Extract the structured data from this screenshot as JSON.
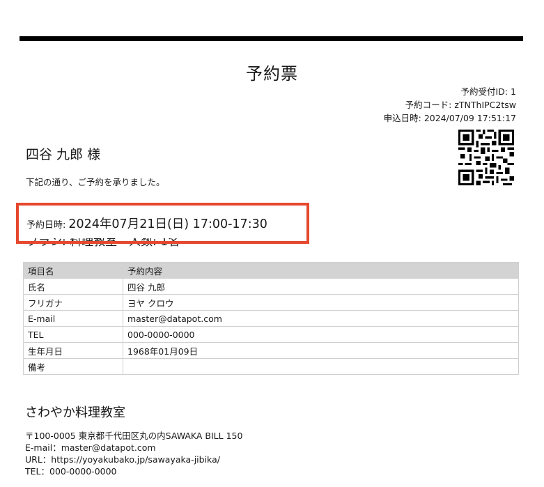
{
  "document": {
    "title": "予約票"
  },
  "meta": {
    "reception_id": "予約受付ID: 1",
    "reservation_code": "予約コード: zTNThIPC2tsw",
    "applied_at": "申込日時: 2024/07/09 17:51:17"
  },
  "customer": {
    "name": "四谷 九郎 様",
    "greeting": "下記の通り、ご予約を承りました。"
  },
  "reservation": {
    "datetime_label": "予約日時:",
    "datetime_value": "2024年07月21日(日) 17:00-17:30",
    "plan_line": "プラン: 料理教室　人数: 1名"
  },
  "table": {
    "headers": [
      "項目名",
      "予約内容"
    ],
    "rows": [
      {
        "label": "氏名",
        "value": "四谷 九郎"
      },
      {
        "label": "フリガナ",
        "value": "ヨヤ クロウ"
      },
      {
        "label": "E-mail",
        "value": "master@datapot.com"
      },
      {
        "label": "TEL",
        "value": "000-0000-0000"
      },
      {
        "label": "生年月日",
        "value": "1968年01月09日"
      },
      {
        "label": "備考",
        "value": ""
      }
    ]
  },
  "shop": {
    "name": "さわやか料理教室",
    "address": "〒100-0005 東京都千代田区丸の内SAWAKA BILL 150",
    "email": "E-mail：master@datapot.com",
    "url": "URL：https://yoyakubako.jp/sawayaka-jibika/",
    "tel": "TEL：000-0000-0000"
  },
  "colors": {
    "highlight_border": "#e5482d",
    "table_header_bg": "#d3d3d3"
  },
  "icons": {
    "qr": "qr-code"
  }
}
